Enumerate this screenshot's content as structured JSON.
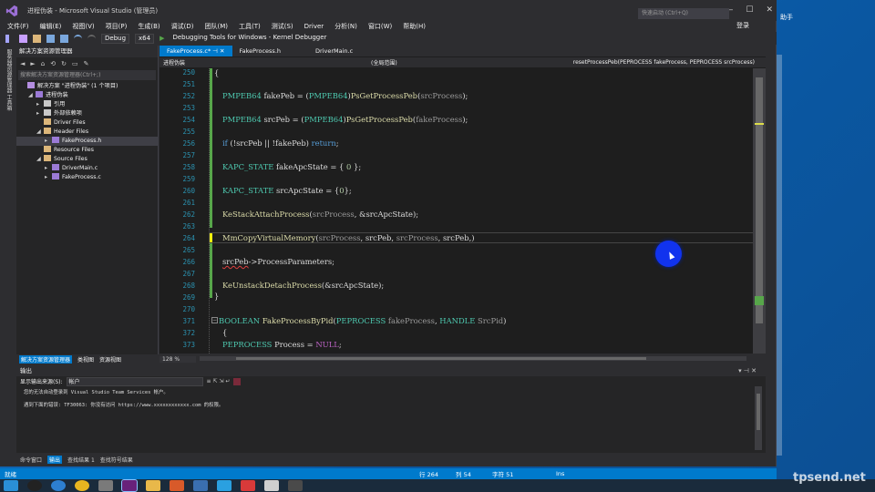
{
  "window": {
    "title": "进程伪装 - Microsoft Visual Studio (管理员)",
    "quick_launch": "快速启动 (Ctrl+Q)",
    "signin": "登录",
    "minimize": "—",
    "maximize": "☐",
    "close": "✕"
  },
  "menu": [
    "文件(F)",
    "编辑(E)",
    "视图(V)",
    "项目(P)",
    "生成(B)",
    "调试(D)",
    "团队(M)",
    "工具(T)",
    "测试(S)",
    "Driver",
    "分析(N)",
    "窗口(W)",
    "帮助(H)"
  ],
  "toolbar": {
    "config": "Debug",
    "platform": "x64",
    "debugger": "Debugging Tools for Windows - Kernel Debugger"
  },
  "side_tabs": "服务器资源管理器  工具箱",
  "solution_explorer": {
    "title": "解决方案资源管理器",
    "search_placeholder": "搜索解决方案资源管理器(Ctrl+;)",
    "items": [
      {
        "label": "解决方案 \"进程伪装\" (1 个项目)",
        "indent": 0,
        "arrow": "",
        "icon": "#b48ee0"
      },
      {
        "label": "进程伪装",
        "indent": 1,
        "arrow": "◢",
        "icon": "#9b7ad6"
      },
      {
        "label": "引用",
        "indent": 2,
        "arrow": "▸",
        "icon": "#c8c8c8"
      },
      {
        "label": "外部依赖项",
        "indent": 2,
        "arrow": "▸",
        "icon": "#c8c8c8"
      },
      {
        "label": "Driver Files",
        "indent": 2,
        "arrow": "",
        "icon": "#dcb67a"
      },
      {
        "label": "Header Files",
        "indent": 2,
        "arrow": "◢",
        "icon": "#dcb67a"
      },
      {
        "label": "FakeProcess.h",
        "indent": 3,
        "arrow": "▸",
        "icon": "#9b7ad6"
      },
      {
        "label": "Resource Files",
        "indent": 2,
        "arrow": "",
        "icon": "#dcb67a"
      },
      {
        "label": "Source Files",
        "indent": 2,
        "arrow": "◢",
        "icon": "#dcb67a"
      },
      {
        "label": "DriverMain.c",
        "indent": 3,
        "arrow": "▸",
        "icon": "#9b7ad6"
      },
      {
        "label": "FakeProcess.c",
        "indent": 3,
        "arrow": "▸",
        "icon": "#9b7ad6"
      }
    ],
    "bottom_tabs": [
      "解决方案资源管理器",
      "类视图",
      "资源视图"
    ]
  },
  "editor": {
    "tabs": [
      "FakeProcess.c*",
      "FakeProcess.h",
      "DriverMain.c"
    ],
    "nav_project": "进程伪装",
    "nav_scope": "(全局范围)",
    "nav_function": "resetProcessPeb(PEPROCESS fakeProcess, PEPROCESS srcProcess)",
    "zoom": "128 %",
    "line_numbers": [
      "250",
      "251",
      "252",
      "253",
      "254",
      "255",
      "256",
      "257",
      "258",
      "259",
      "260",
      "261",
      "262",
      "263",
      "264",
      "265",
      "266",
      "267",
      "268",
      "269",
      "270",
      "371",
      "372",
      "373",
      "374"
    ],
    "code": [
      "",
      "PMPEB64 fakePeb = (PMPEB64)PsGetProcessPeb(srcProcess);",
      "PMPEB64 srcPeb = (PMPEB64)PsGetProcessPeb(fakeProcess);",
      "if (!srcPeb || !fakePeb) return;",
      "KAPC_STATE fakeApcState = { 0 };",
      "KAPC_STATE srcApcState = {0};",
      "KeStackAttachProcess(srcProcess, &srcApcState);",
      "MmCopyVirtualMemory(srcProcess, srcPeb, srcProcess, srcPeb,)",
      "srcPeb->ProcessParameters;",
      "KeUnstackDetachProcess(&srcApcState);",
      "BOOLEAN FakeProcessByPid(PEPROCESS fakeProcess, HANDLE SrcPid)",
      "PEPROCESS Process = NULL;"
    ]
  },
  "output": {
    "title": "输出",
    "source_label": "显示输出来源(S):",
    "source_value": "帐户",
    "lines": [
      "您的无法自动登录到 Visual Studio Team Services 帐户。",
      "遇到下面的错误: TF30063: 你没有访问 https://www.xxxxxxxxxxxx.com 的权限。"
    ],
    "bottom_tabs": [
      "命令窗口",
      "输出",
      "查找结果 1",
      "查找符号结果"
    ]
  },
  "status": {
    "ready": "就绪",
    "line": "行 264",
    "col": "列 54",
    "ch": "字符 51",
    "mode": "Ins"
  },
  "desktop": {
    "label": "助手",
    "watermark": "tpsend.net"
  }
}
